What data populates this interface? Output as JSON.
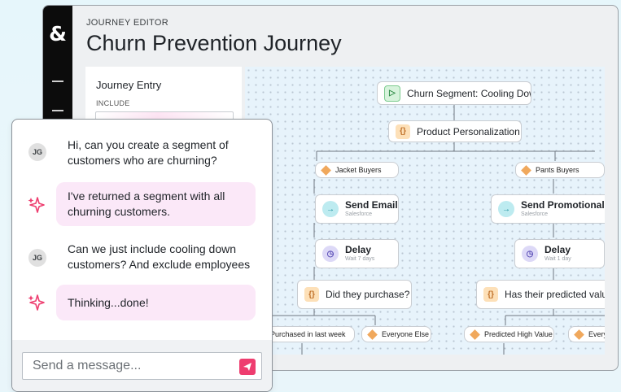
{
  "app": {
    "logo_text": "&",
    "eyebrow": "JOURNEY EDITOR",
    "title": "Churn Prevention Journey"
  },
  "entry_panel": {
    "title": "Journey Entry",
    "include_label": "INCLUDE"
  },
  "canvas": {
    "root": "Churn Segment: Cooling Down",
    "personalization": "Product Personalization",
    "left_branch": {
      "segment": "Jacket Buyers",
      "action_title": "Send Email",
      "action_sub": "Salesforce",
      "delay_title": "Delay",
      "delay_sub": "Wait 7 days",
      "decision": "Did they purchase?",
      "outcome_a": "Purchased in last week",
      "outcome_b": "Everyone Else"
    },
    "right_branch": {
      "segment": "Pants Buyers",
      "action_title": "Send Promotional Ma",
      "action_sub": "Salesforce",
      "delay_title": "Delay",
      "delay_sub": "Wait 1 day",
      "decision": "Has their predicted value",
      "outcome_a": "Predicted High Value",
      "outcome_b": "Every"
    }
  },
  "chat": {
    "messages": [
      {
        "role": "user",
        "initials": "JG",
        "text": "Hi, can you create a segment of customers who are churning?"
      },
      {
        "role": "assistant",
        "text": "I've returned a segment with all churning customers."
      },
      {
        "role": "user",
        "initials": "JG",
        "text": "Can we just include cooling down customers? And exclude employees"
      },
      {
        "role": "assistant",
        "text": "Thinking...done!"
      }
    ],
    "input_placeholder": "Send a message..."
  },
  "colors": {
    "accent_pink": "#ee3d6f",
    "bubble_pink": "#fbe8f8",
    "diamond_orange": "#f0a85c",
    "rail_black": "#0c0c0c"
  }
}
